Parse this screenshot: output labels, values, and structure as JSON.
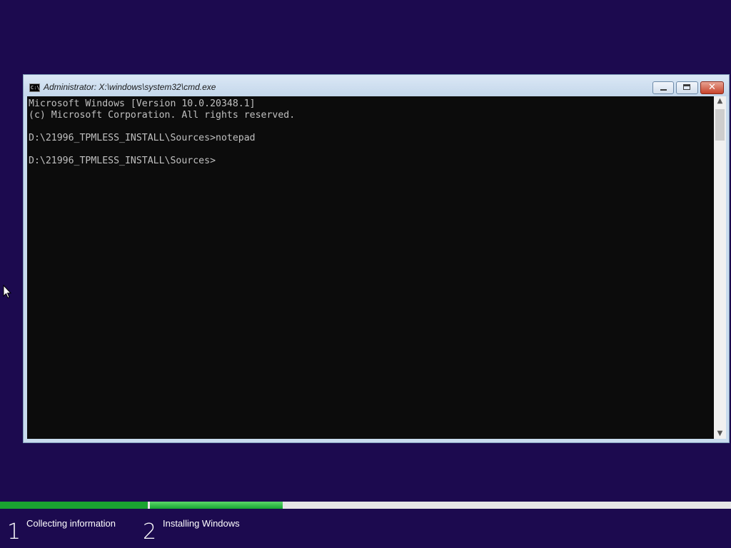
{
  "window": {
    "title": "Administrator: X:\\windows\\system32\\cmd.exe",
    "icon": "cmd-icon",
    "icon_text": "C:\\",
    "close_glyph": "✕"
  },
  "console": {
    "lines": [
      "Microsoft Windows [Version 10.0.20348.1]",
      "(c) Microsoft Corporation. All rights reserved.",
      "",
      "D:\\21996_TPMLESS_INSTALL\\Sources>notepad",
      "",
      "D:\\21996_TPMLESS_INSTALL\\Sources>"
    ]
  },
  "scrollbar": {
    "up_glyph": "▲",
    "down_glyph": "▼"
  },
  "setup": {
    "steps": [
      {
        "number": "1",
        "label": "Collecting information"
      },
      {
        "number": "2",
        "label": "Installing Windows"
      }
    ],
    "progress_colors": {
      "complete": "#1aa331",
      "active": "#5cd86a",
      "track": "#e6e6e6"
    }
  },
  "colors": {
    "background": "#1c0a4f",
    "console_bg": "#0c0c0c",
    "console_text": "#c0c0c0"
  }
}
